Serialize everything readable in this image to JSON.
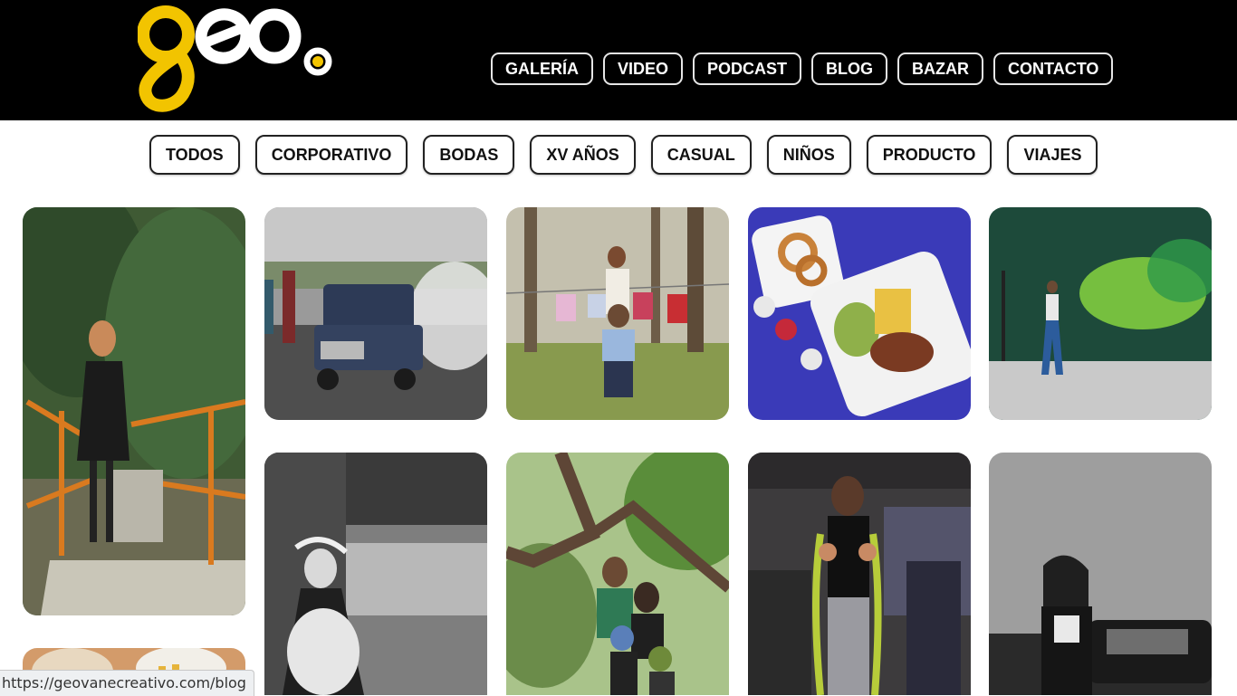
{
  "header": {
    "logo_text": "geo",
    "nav": [
      {
        "label": "GALERÍA"
      },
      {
        "label": "VIDEO"
      },
      {
        "label": "PODCAST"
      },
      {
        "label": "BLOG"
      },
      {
        "label": "BAZAR"
      },
      {
        "label": "CONTACTO"
      }
    ]
  },
  "filters": [
    {
      "label": "TODOS"
    },
    {
      "label": "CORPORATIVO"
    },
    {
      "label": "BODAS"
    },
    {
      "label": "XV AÑOS"
    },
    {
      "label": "CASUAL"
    },
    {
      "label": "NIÑOS"
    },
    {
      "label": "PRODUCTO"
    },
    {
      "label": "VIAJES"
    }
  ],
  "colors": {
    "header_bg": "#000000",
    "logo_yellow": "#f2c400",
    "logo_white": "#ffffff"
  },
  "status_bar": {
    "url": "https://geovanecreativo.com/blog"
  }
}
